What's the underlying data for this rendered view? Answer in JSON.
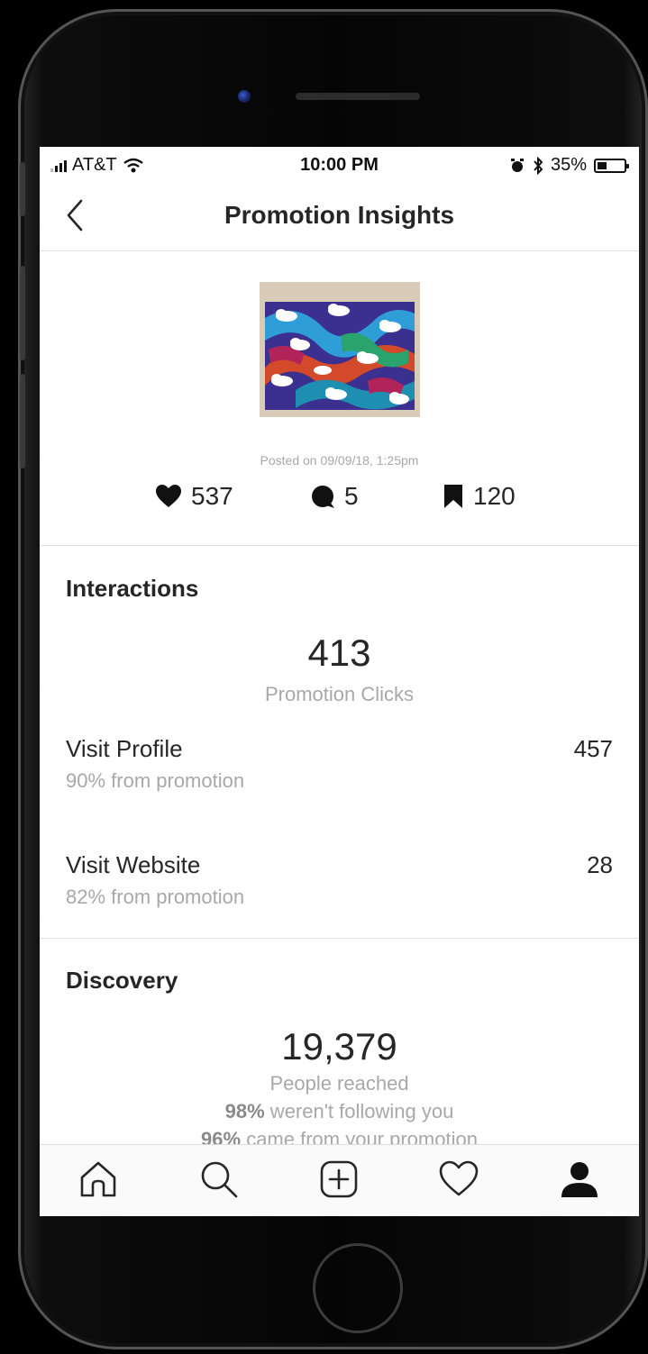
{
  "status_bar": {
    "carrier": "AT&T",
    "time": "10:00 PM",
    "battery": "35%",
    "battery_level": 0.35
  },
  "header": {
    "title": "Promotion Insights",
    "back_icon": "chevron-left-icon"
  },
  "post": {
    "posted_text": "Posted on 09/09/18, 1:25pm",
    "likes": "537",
    "comments": "5",
    "saves": "120"
  },
  "interactions": {
    "title": "Interactions",
    "clicks_value": "413",
    "clicks_label": "Promotion Clicks",
    "rows": [
      {
        "label": "Visit Profile",
        "sub": "90% from promotion",
        "value": "457"
      },
      {
        "label": "Visit Website",
        "sub": "82% from promotion",
        "value": "28"
      }
    ]
  },
  "discovery": {
    "title": "Discovery",
    "reach_value": "19,379",
    "reach_label": "People reached",
    "line1_pct": "98%",
    "line1_text": " weren't following you",
    "line2_pct": "96%",
    "line2_text": " came from your promotion"
  },
  "tabs": [
    "home-icon",
    "search-icon",
    "add-icon",
    "heart-icon",
    "profile-icon"
  ],
  "colors": {
    "text": "#262626",
    "secondary": "#a8a8a8",
    "divider": "#e2e2e2"
  }
}
